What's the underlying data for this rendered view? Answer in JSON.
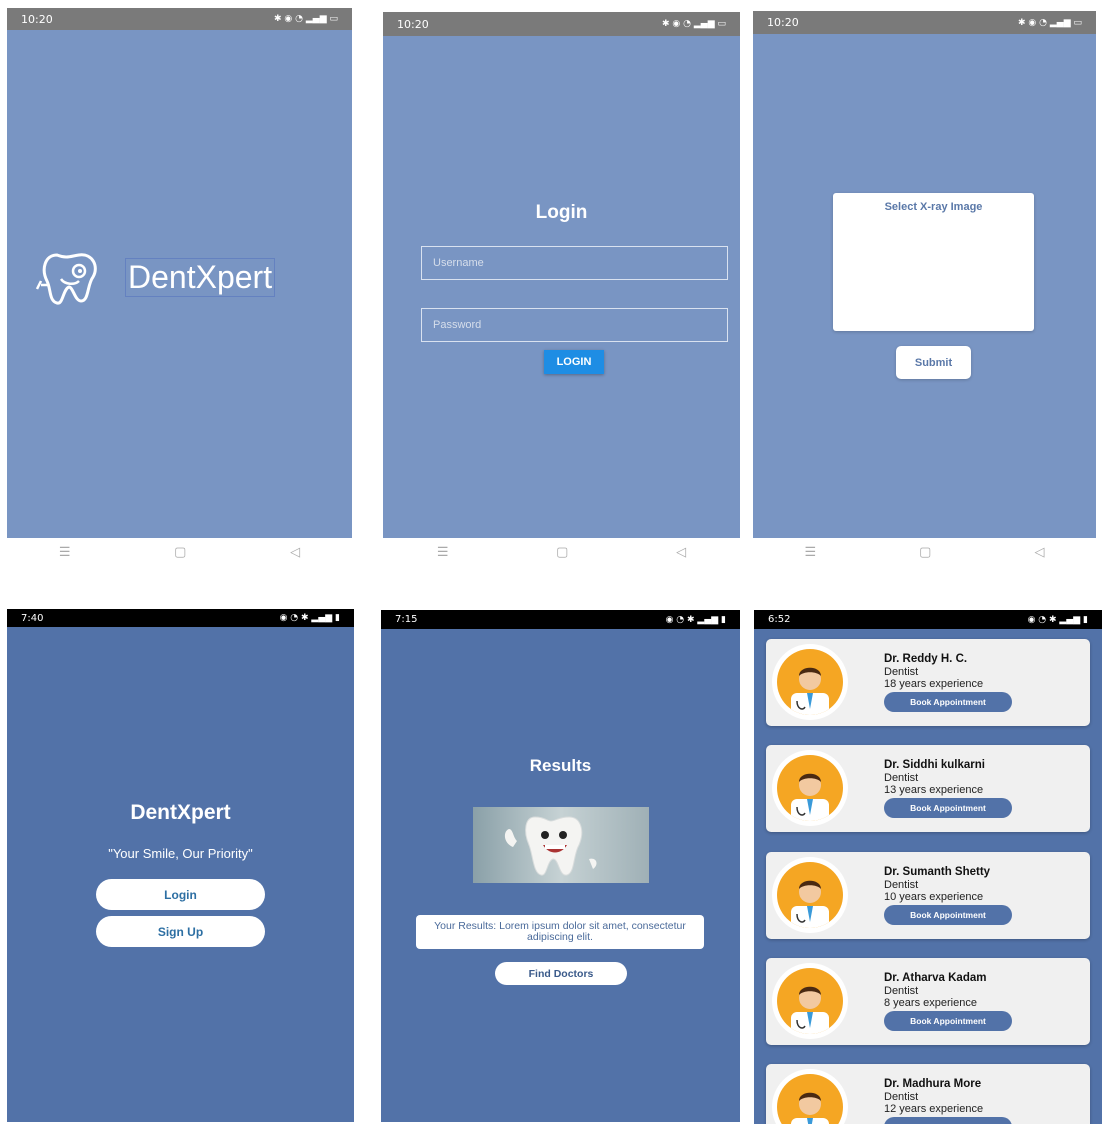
{
  "splash": {
    "status_time": "10:20",
    "brand": "DentXpert"
  },
  "login": {
    "status_time": "10:20",
    "title": "Login",
    "username_placeholder": "Username",
    "password_placeholder": "Password",
    "button": "LOGIN"
  },
  "upload": {
    "status_time": "10:20",
    "select_label": "Select X-ray Image",
    "submit": "Submit"
  },
  "welcome": {
    "status_time": "7:40",
    "title": "DentXpert",
    "tagline": "\"Your Smile, Our Priority\"",
    "login": "Login",
    "signup": "Sign Up"
  },
  "results": {
    "status_time": "7:15",
    "title": "Results",
    "text": "Your Results: Lorem ipsum dolor sit amet, consectetur adipiscing elit.",
    "find_doctors": "Find Doctors"
  },
  "doctors": {
    "status_time": "6:52",
    "book_label": "Book Appointment",
    "list": [
      {
        "name": "Dr. Reddy H. C.",
        "role": "Dentist",
        "experience": "18 years experience"
      },
      {
        "name": "Dr. Siddhi kulkarni",
        "role": "Dentist",
        "experience": "13 years experience"
      },
      {
        "name": "Dr. Sumanth Shetty",
        "role": "Dentist",
        "experience": "10 years experience"
      },
      {
        "name": "Dr. Atharva Kadam",
        "role": "Dentist",
        "experience": "8 years experience"
      },
      {
        "name": "Dr. Madhura More",
        "role": "Dentist",
        "experience": "12 years experience"
      }
    ]
  },
  "nav_icons": [
    "menu-icon",
    "home-icon",
    "back-icon"
  ],
  "colors": {
    "screen_light": "#7995c3",
    "screen_dark": "#5272a8",
    "login_button": "#1e8de4",
    "avatar_bg": "#f5a623"
  }
}
